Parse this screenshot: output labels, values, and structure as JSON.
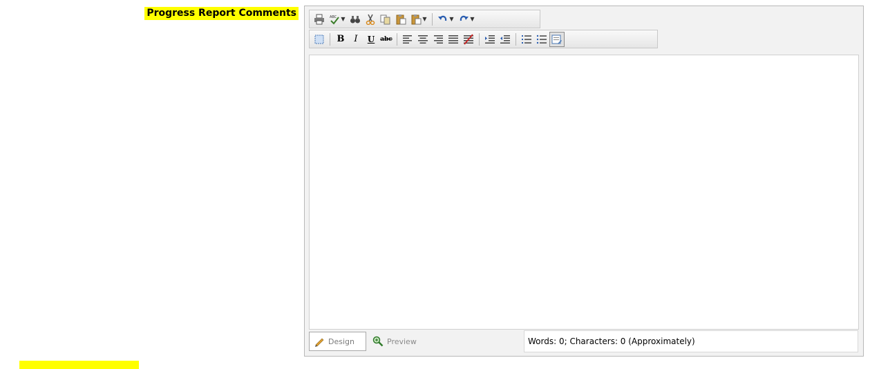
{
  "field": {
    "label": "Progress Report Comments"
  },
  "editor": {
    "content": "",
    "modes": {
      "design": "Design",
      "preview": "Preview"
    },
    "status": "Words: 0; Characters: 0 (Approximately)"
  },
  "toolbar": {
    "row1": [
      "print-icon",
      "spellcheck-icon",
      "find-icon",
      "cut-icon",
      "copy-icon",
      "paste-icon",
      "paste-options-icon",
      "undo-icon",
      "redo-icon"
    ],
    "row2": [
      "select-all-icon",
      "bold-icon",
      "italic-icon",
      "underline-icon",
      "strikethrough-icon",
      "align-left-icon",
      "align-center-icon",
      "align-right-icon",
      "justify-icon",
      "clear-alignment-icon",
      "indent-icon",
      "outdent-icon",
      "numbered-list-icon",
      "bulleted-list-icon",
      "format-stripper-icon"
    ],
    "labels": {
      "bold": "B",
      "italic": "I",
      "underline": "U",
      "strike": "abc"
    }
  },
  "colors": {
    "highlight": "#ffff00",
    "toolbar_bg": "#eeeeee",
    "border": "#b8b8b8"
  }
}
